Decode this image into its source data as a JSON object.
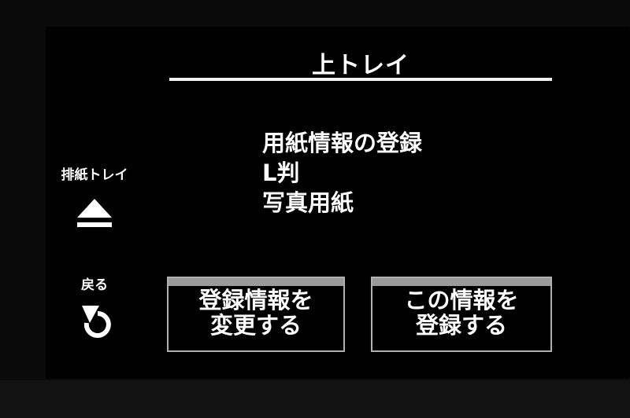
{
  "header": {
    "title": "上トレイ"
  },
  "info": {
    "lines": [
      "用紙情報の登録",
      "L判",
      "写真用紙"
    ]
  },
  "side": {
    "eject_label": "排紙トレイ",
    "back_label": "戻る"
  },
  "buttons": {
    "change": {
      "line1": "登録情報を",
      "line2": "変更する"
    },
    "register": {
      "line1": "この情報を",
      "line2": "登録する"
    }
  }
}
